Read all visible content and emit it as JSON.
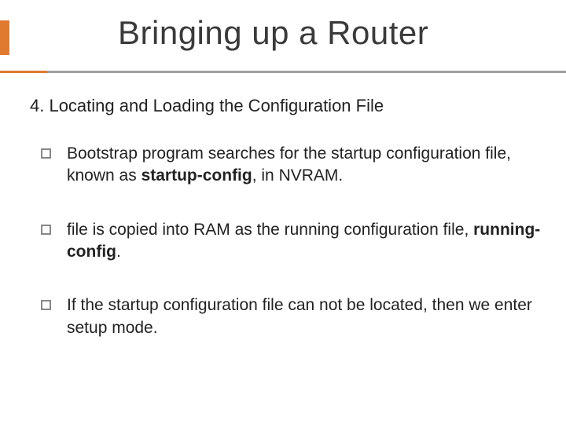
{
  "title": "Bringing up a Router",
  "section_heading": "4. Locating and Loading the Configuration File",
  "bullets": [
    {
      "pre": "Bootstrap program searches for the startup configuration file, known as ",
      "bold1": "startup-config",
      "post": ", in NVRAM."
    },
    {
      "pre": "file is copied into RAM as the running configuration file, ",
      "bold1": "running-config",
      "post": "."
    },
    {
      "pre": "If the startup configuration file can not be located, then we enter setup mode."
    }
  ],
  "colors": {
    "accent": "#e07a2e",
    "rule_grey": "#9f9f9f",
    "text": "#222222",
    "bullet_border": "#888888"
  }
}
